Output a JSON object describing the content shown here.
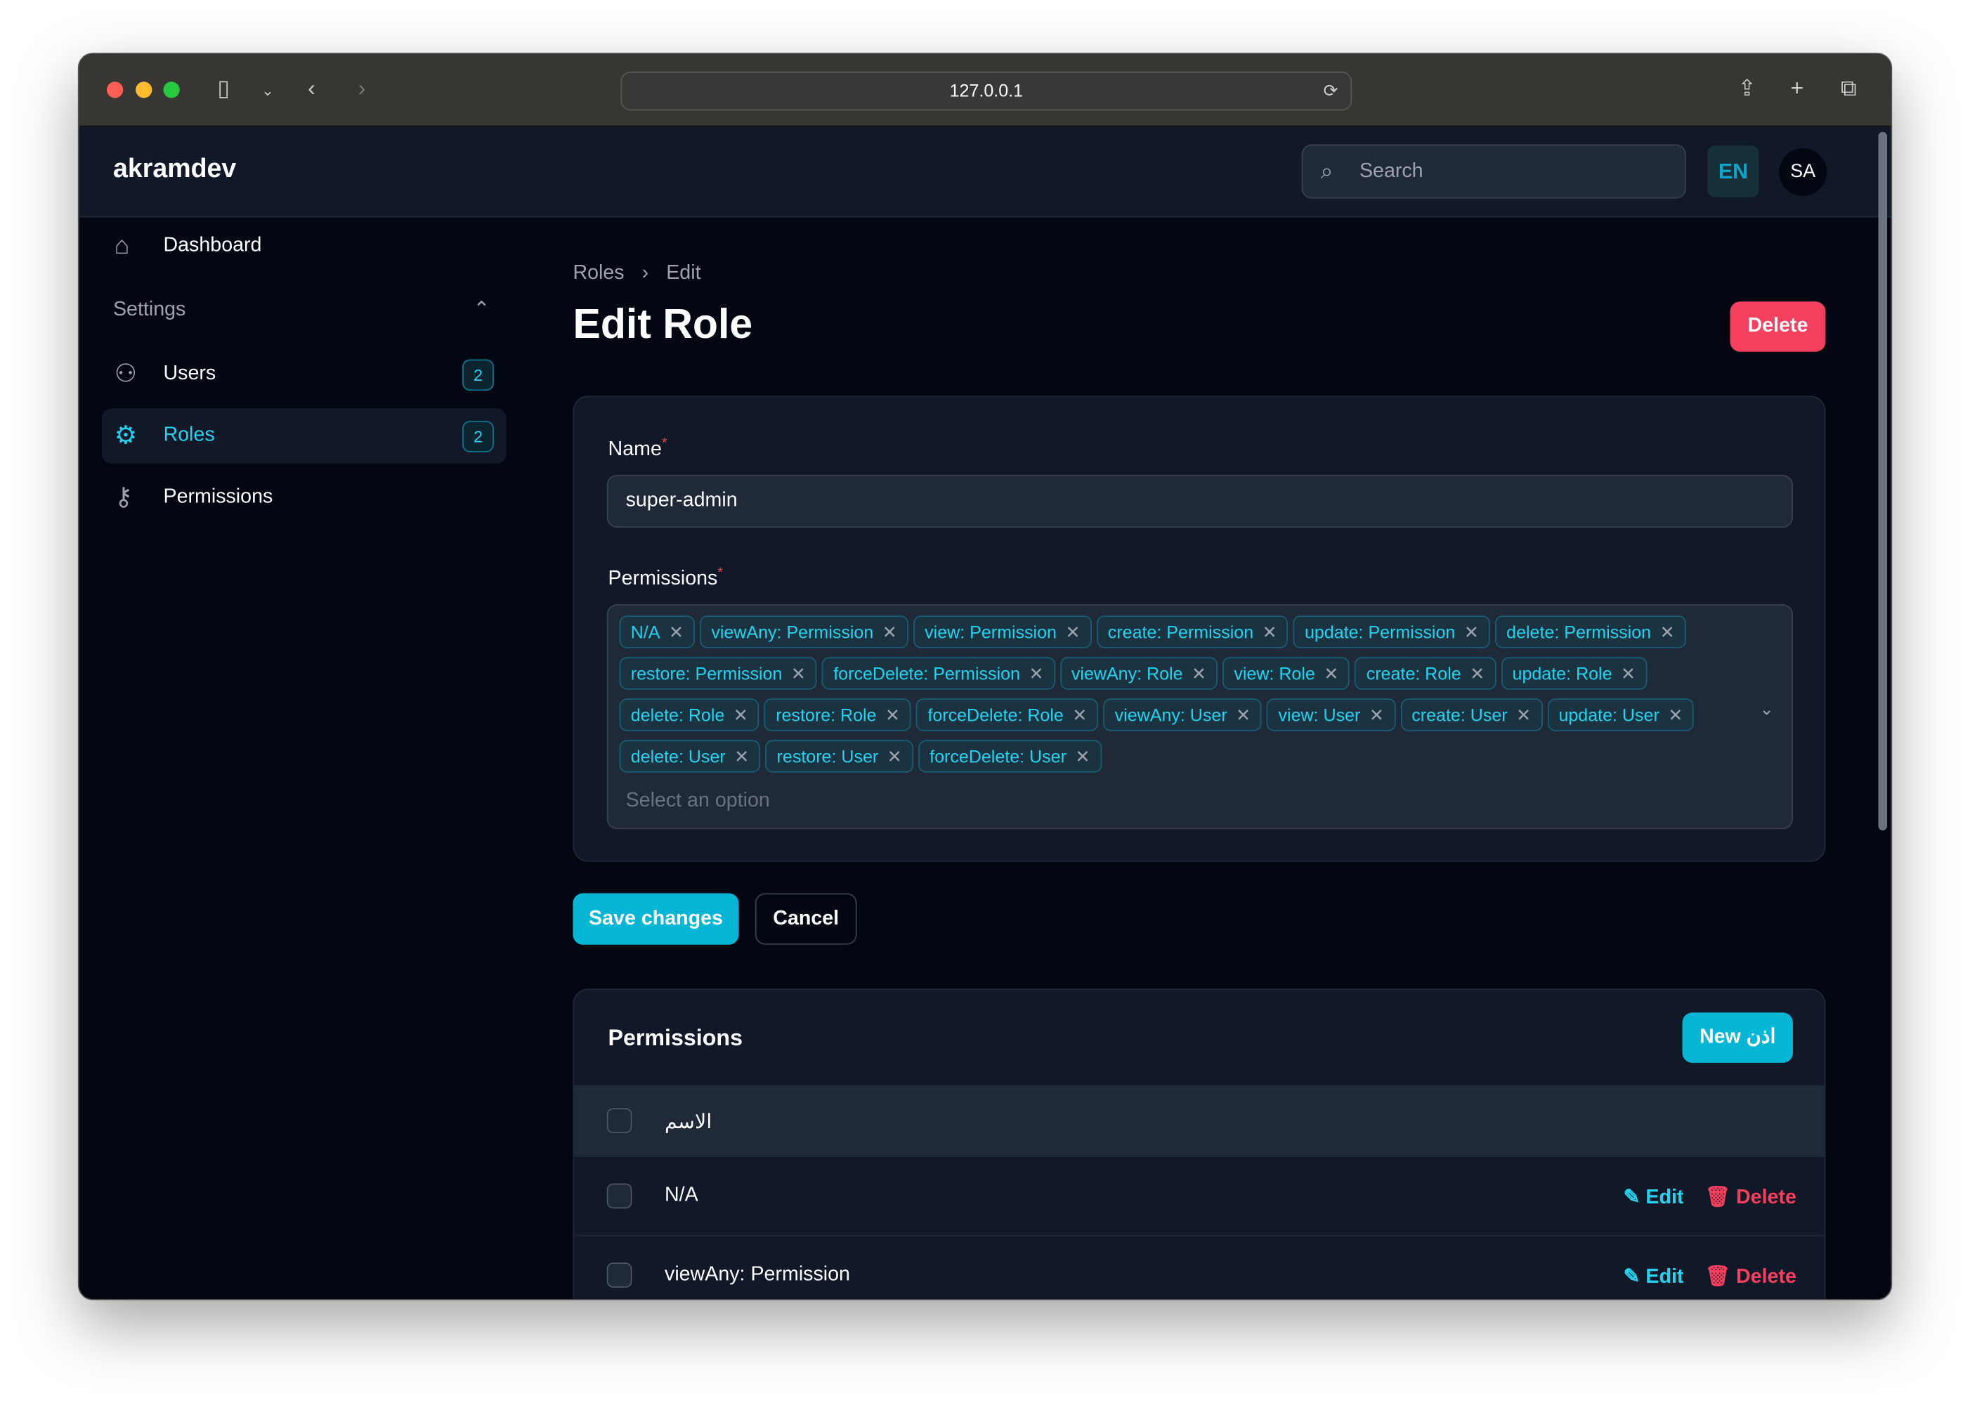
{
  "browser": {
    "url": "127.0.0.1"
  },
  "app": {
    "brand": "akramdev",
    "search_placeholder": "Search",
    "lang": "EN",
    "avatar": "SA"
  },
  "sidebar": {
    "dashboard": "Dashboard",
    "group": "Settings",
    "items": [
      {
        "label": "Users",
        "count": "2"
      },
      {
        "label": "Roles",
        "count": "2"
      },
      {
        "label": "Permissions"
      }
    ]
  },
  "page": {
    "breadcrumb": [
      "Roles",
      "Edit"
    ],
    "title": "Edit Role",
    "delete": "Delete"
  },
  "form": {
    "name_label": "Name",
    "name_value": "super-admin",
    "permissions_label": "Permissions",
    "placeholder": "Select an option",
    "tags": [
      "N/A",
      "viewAny: Permission",
      "view: Permission",
      "create: Permission",
      "update: Permission",
      "delete: Permission",
      "restore: Permission",
      "forceDelete: Permission",
      "viewAny: Role",
      "view: Role",
      "create: Role",
      "update: Role",
      "delete: Role",
      "restore: Role",
      "forceDelete: Role",
      "viewAny: User",
      "view: User",
      "create: User",
      "update: User",
      "delete: User",
      "restore: User",
      "forceDelete: User"
    ],
    "save": "Save changes",
    "cancel": "Cancel"
  },
  "relation": {
    "title": "Permissions",
    "new": "New اذن",
    "column": "الاسم",
    "rows": [
      "N/A",
      "viewAny: Permission"
    ],
    "edit": "Edit",
    "delete": "Delete"
  },
  "colors": {
    "accent": "#06b6d4",
    "danger": "#f43f5e"
  }
}
